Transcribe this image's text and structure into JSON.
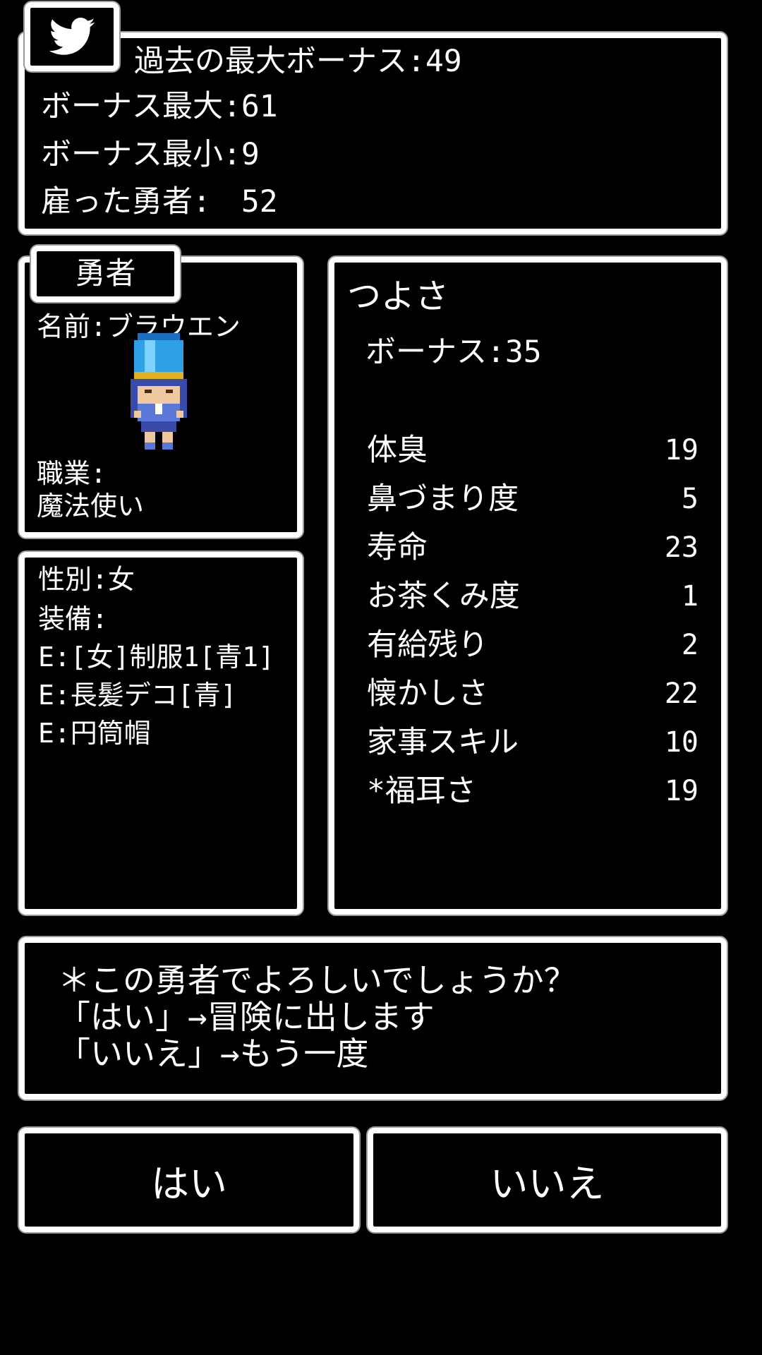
{
  "top_panel": {
    "past_max_bonus": "過去の最大ボーナス:49",
    "bonus_max": "ボーナス最大:61",
    "bonus_min": "ボーナス最小:9",
    "hired_heroes": "雇った勇者:　52"
  },
  "hero_panel": {
    "title": "勇者",
    "name": "名前:ブラウエン",
    "job_label": "職業:",
    "job_value": "魔法使い"
  },
  "equip_panel": {
    "gender": "性別:女",
    "equip_label": "装備:",
    "items": [
      "E:[女]制服1[青1]",
      "E:長髪デコ[青]",
      "E:円筒帽"
    ]
  },
  "stats_panel": {
    "title": "つよさ",
    "bonus": "ボーナス:35",
    "stats": [
      {
        "name": "体臭",
        "value": "19"
      },
      {
        "name": "鼻づまり度",
        "value": "5"
      },
      {
        "name": "寿命",
        "value": "23"
      },
      {
        "name": "お茶くみ度",
        "value": "1"
      },
      {
        "name": "有給残り",
        "value": "2"
      },
      {
        "name": "懐かしさ",
        "value": "22"
      },
      {
        "name": "家事スキル",
        "value": "10"
      },
      {
        "name": "*福耳さ",
        "value": "19"
      }
    ]
  },
  "message": {
    "line1": "＊この勇者でよろしいでしょうか？",
    "line2": "「はい」→冒険に出します",
    "line3": "「いいえ」→もう一度"
  },
  "buttons": {
    "yes": "はい",
    "no": "いいえ"
  },
  "icons": {
    "twitter": "twitter-bird-icon",
    "hero": "hero-sprite"
  },
  "colors": {
    "background": "#000000",
    "frame": "#ffffff",
    "twitter_bird": "#ffffff"
  }
}
